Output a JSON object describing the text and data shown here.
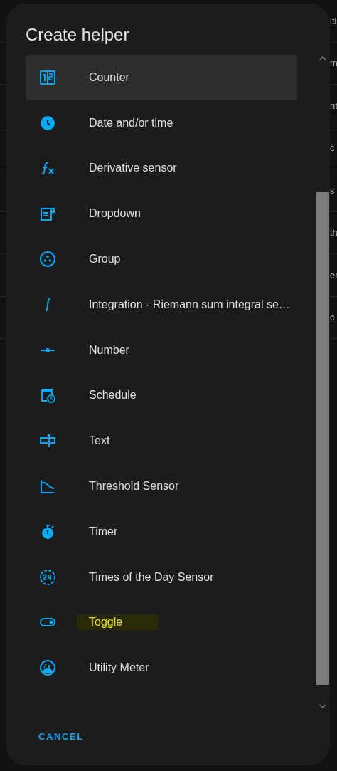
{
  "background": {
    "row_texts": [
      "iti",
      "m",
      "nt",
      "c",
      "s",
      "th",
      "er",
      "c"
    ]
  },
  "dialog": {
    "title": "Create helper",
    "items": [
      {
        "label": "Counter",
        "hovered": true,
        "highlighted": false
      },
      {
        "label": "Date and/or time",
        "hovered": false,
        "highlighted": false
      },
      {
        "label": "Derivative sensor",
        "hovered": false,
        "highlighted": false
      },
      {
        "label": "Dropdown",
        "hovered": false,
        "highlighted": false
      },
      {
        "label": "Group",
        "hovered": false,
        "highlighted": false
      },
      {
        "label": "Integration - Riemann sum integral se…",
        "hovered": false,
        "highlighted": false
      },
      {
        "label": "Number",
        "hovered": false,
        "highlighted": false
      },
      {
        "label": "Schedule",
        "hovered": false,
        "highlighted": false
      },
      {
        "label": "Text",
        "hovered": false,
        "highlighted": false
      },
      {
        "label": "Threshold Sensor",
        "hovered": false,
        "highlighted": false
      },
      {
        "label": "Timer",
        "hovered": false,
        "highlighted": false
      },
      {
        "label": "Times of the Day Sensor",
        "hovered": false,
        "highlighted": false
      },
      {
        "label": "Toggle",
        "hovered": false,
        "highlighted": true
      },
      {
        "label": "Utility Meter",
        "hovered": false,
        "highlighted": false
      }
    ],
    "cancel": "CANCEL"
  }
}
